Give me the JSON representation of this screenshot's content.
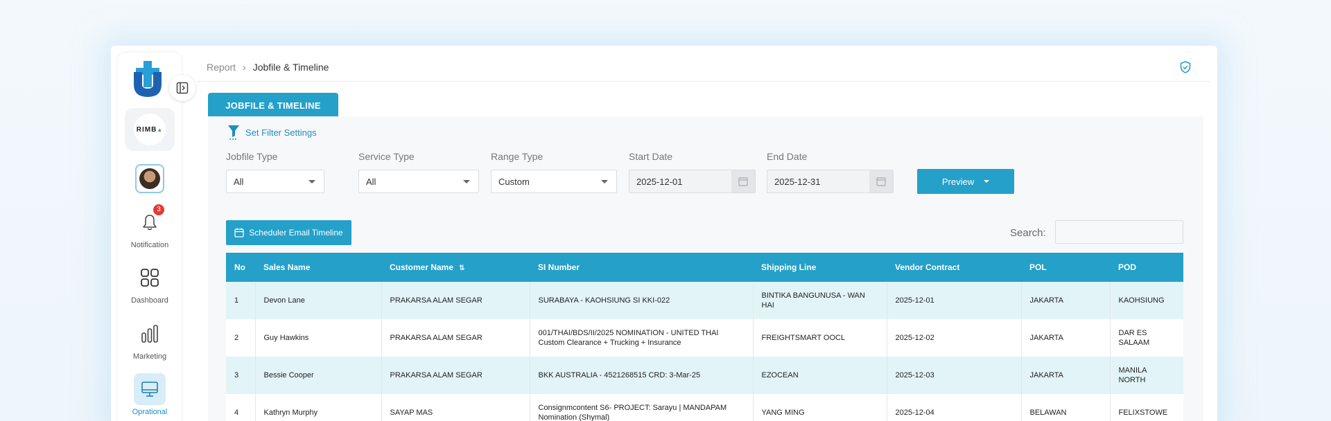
{
  "breadcrumb": {
    "parent": "Report",
    "separator": "›",
    "current": "Jobfile & Timeline"
  },
  "sidebar": {
    "company_logo_text": "RIMB",
    "notification_count": "3",
    "items": [
      {
        "label": "Notification",
        "icon": "bell-icon"
      },
      {
        "label": "Dashboard",
        "icon": "grid-icon"
      },
      {
        "label": "Marketing",
        "icon": "bar-chart-icon"
      },
      {
        "label": "Oprational",
        "icon": "monitor-icon",
        "active": true
      }
    ]
  },
  "tab": {
    "label": "JOBFILE & TIMELINE"
  },
  "filters": {
    "link_label": "Set Filter Settings",
    "jobfile_type": {
      "label": "Jobfile Type",
      "value": "All"
    },
    "service_type": {
      "label": "Service Type",
      "value": "All"
    },
    "range_type": {
      "label": "Range Type",
      "value": "Custom"
    },
    "start_date": {
      "label": "Start Date",
      "value": "2025-12-01"
    },
    "end_date": {
      "label": "End Date",
      "value": "2025-12-31"
    },
    "preview_label": "Preview"
  },
  "toolbar": {
    "scheduler_label": "Scheduler Email Timeline",
    "search_label": "Search:",
    "search_value": ""
  },
  "table": {
    "columns": [
      "No",
      "Sales Name",
      "Customer Name",
      "SI Number",
      "Shipping Line",
      "Vendor Contract",
      "POL",
      "POD"
    ],
    "rows": [
      [
        "1",
        "Devon Lane",
        "PRAKARSA ALAM SEGAR",
        "SURABAYA - KAOHSIUNG SI KKI-022",
        "BINTIKA BANGUNUSA - WAN HAI",
        "2025-12-01",
        "JAKARTA",
        "KAOHSIUNG"
      ],
      [
        "2",
        "Guy Hawkins",
        "PRAKARSA ALAM SEGAR",
        "001/THAI/BDS/II/2025 NOMINATION - UNITED THAI Custom Clearance + Trucking + Insurance",
        "FREIGHTSMART OOCL",
        "2025-12-02",
        "JAKARTA",
        "DAR ES SALAAM"
      ],
      [
        "3",
        "Bessie Cooper",
        "PRAKARSA ALAM SEGAR",
        "BKK AUSTRALIA - 4521268515 CRD: 3-Mar-25",
        "EZOCEAN",
        "2025-12-03",
        "JAKARTA",
        "MANILA NORTH"
      ],
      [
        "4",
        "Kathryn Murphy",
        "SAYAP MAS",
        "Consignmcontent S6- PROJECT: Sarayu | MANDAPAM Nomination (Shymal)",
        "YANG MING",
        "2025-12-04",
        "BELAWAN",
        "FELIXSTOWE"
      ]
    ]
  },
  "colors": {
    "accent": "#24a0c9",
    "row_alt": "#e2f4f7",
    "badge": "#e53935"
  }
}
